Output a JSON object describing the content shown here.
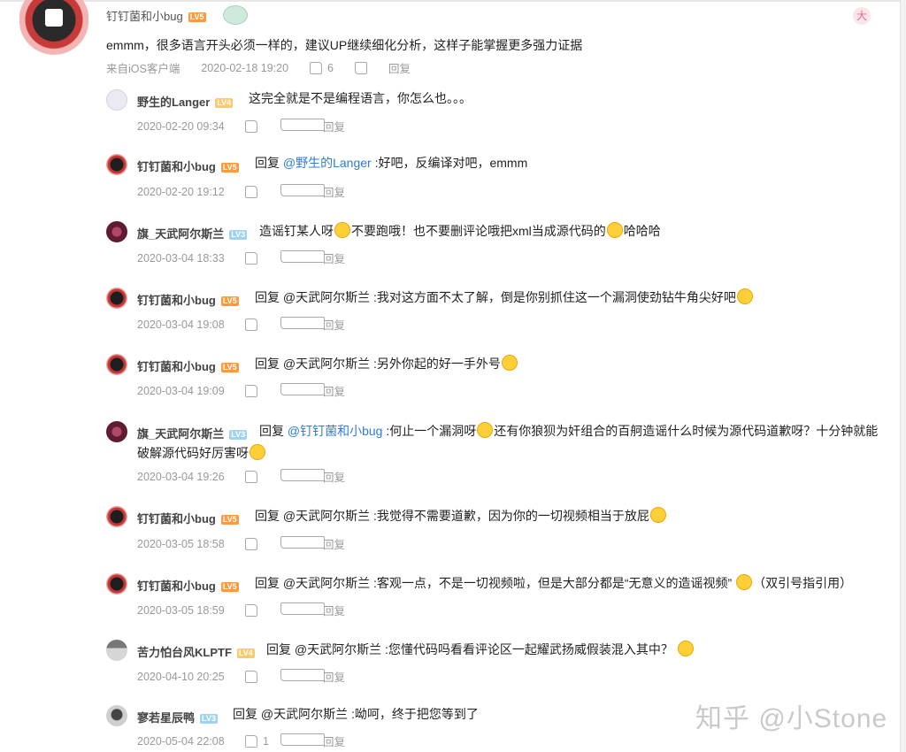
{
  "main_comment": {
    "username": "钉钉菌和小bug",
    "level": "LV5",
    "corner_badge": "大",
    "content": "emmm，很多语言开头必须一样的，建议UP继续细化分析，这样子能掌握更多强力证据",
    "client": "来自iOS客户端",
    "date": "2020-02-18 19:20",
    "likes": "6",
    "reply_label": "回复"
  },
  "replies": [
    {
      "username": "野生的Langer",
      "level": "LV4",
      "text": "这完全就是不是编程语言，你怎么也。。。",
      "date": "2020-02-20 09:34",
      "likes": "",
      "reply_label": "回复"
    },
    {
      "username": "钉钉菌和小bug",
      "level": "LV5",
      "prefix": "回复 ",
      "mention": "@野生的Langer",
      "text": " :好吧，反编译对吧，emmm",
      "date": "2020-02-20 19:12",
      "likes": "",
      "reply_label": "回复"
    },
    {
      "username": "旗_天武阿尔斯兰",
      "level": "LV3",
      "text_a": "造谣钉某人呀",
      "text_b": "不要跑哦！也不要删评论哦把xml当成源代码的",
      "text_c": "哈哈哈",
      "date": "2020-03-04 18:33",
      "likes": "",
      "reply_label": "回复"
    },
    {
      "username": "钉钉菌和小bug",
      "level": "LV5",
      "text": "回复 @天武阿尔斯兰 :我对这方面不太了解，倒是你别抓住这一个漏洞使劲钻牛角尖好吧",
      "date": "2020-03-04 19:08",
      "likes": "",
      "reply_label": "回复"
    },
    {
      "username": "钉钉菌和小bug",
      "level": "LV5",
      "text": "回复 @天武阿尔斯兰 :另外你起的好一手外号",
      "date": "2020-03-04 19:09",
      "likes": "",
      "reply_label": "回复"
    },
    {
      "username": "旗_天武阿尔斯兰",
      "level": "LV3",
      "prefix": "回复 ",
      "mention": "@钉钉菌和小bug",
      "text_a": " :何止一个漏洞呀",
      "text_b": "还有你狼狈为奸组合的百舸造谣什么时候为源代码道歉呀？十分钟就能",
      "text_line2": "破解源代码好厉害呀",
      "date": "2020-03-04 19:26",
      "likes": "",
      "reply_label": "回复"
    },
    {
      "username": "钉钉菌和小bug",
      "level": "LV5",
      "text": "回复 @天武阿尔斯兰 :我觉得不需要道歉，因为你的一切视频相当于放屁",
      "date": "2020-03-05 18:58",
      "likes": "",
      "reply_label": "回复"
    },
    {
      "username": "钉钉菌和小bug",
      "level": "LV5",
      "text_a": "回复 @天武阿尔斯兰 :客观一点，不是一切视频啦，但是大部分都是“无意义的造谣视频”",
      "text_b": "（双引号指引用）",
      "date": "2020-03-05 18:59",
      "likes": "",
      "reply_label": "回复"
    },
    {
      "username": "苦力怕台风KLPTF",
      "level": "LV4",
      "text": "回复 @天武阿尔斯兰 :您懂代码吗看看评论区一起耀武扬威假装混入其中？",
      "date": "2020-04-10 20:25",
      "likes": "",
      "reply_label": "回复"
    },
    {
      "username": "寥若星辰鸭",
      "level": "LV3",
      "text": "回复 @天武阿尔斯兰 :呦呵，终于把您等到了",
      "date": "2020-05-04 22:08",
      "likes": "1",
      "reply_label": "回复"
    }
  ],
  "watermark": "知乎 @小Stone",
  "colors": {
    "link": "#2e7dd6",
    "meta_gray": "#999999",
    "level_orange": "#ff9a3c",
    "level_blue": "#9ed3f2"
  }
}
